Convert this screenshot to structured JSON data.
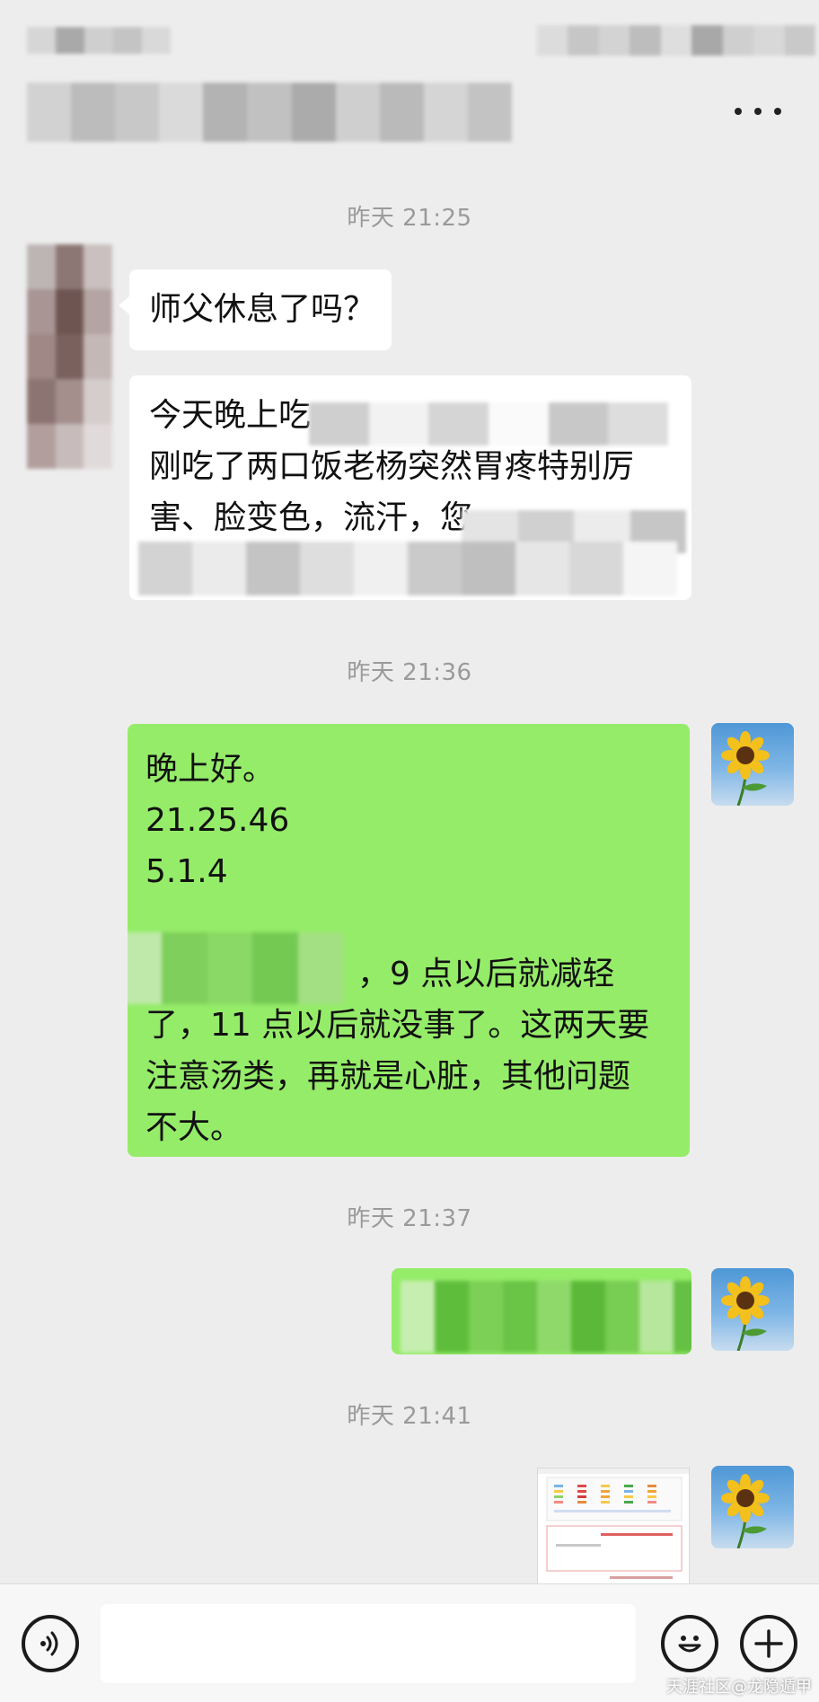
{
  "header": {
    "more_icon": "more-horizontal-icon"
  },
  "messages": [
    {
      "time": "昨天 21:25",
      "incoming": [
        {
          "lines": [
            "师父休息了吗？"
          ]
        },
        {
          "lines": [
            "今天晚上吃",
            "刚吃了两口饭老杨突然胃疼特别厉",
            "害、脸变色，流汗，您"
          ]
        }
      ]
    },
    {
      "time": "昨天 21:36",
      "outgoing": {
        "lines": [
          "晚上好。",
          "21.25.46",
          "5.1.4",
          "",
          "，9 点以后就减轻",
          "了，11 点以后就没事了。这两天要",
          "注意汤类，再就是心脏，其他问题",
          "不大。"
        ]
      }
    },
    {
      "time": "昨天 21:37"
    },
    {
      "time": "昨天 21:41"
    }
  ],
  "input_bar": {
    "voice_icon": "voice-input-icon",
    "emoji_icon": "emoji-icon",
    "plus_icon": "plus-icon",
    "placeholder": ""
  },
  "watermark": "天涯社区@龙隐遁甲",
  "colors": {
    "background": "#ededed",
    "outgoing_bubble": "#95ec69",
    "incoming_bubble": "#ffffff",
    "timestamp": "#9a9a9a"
  }
}
